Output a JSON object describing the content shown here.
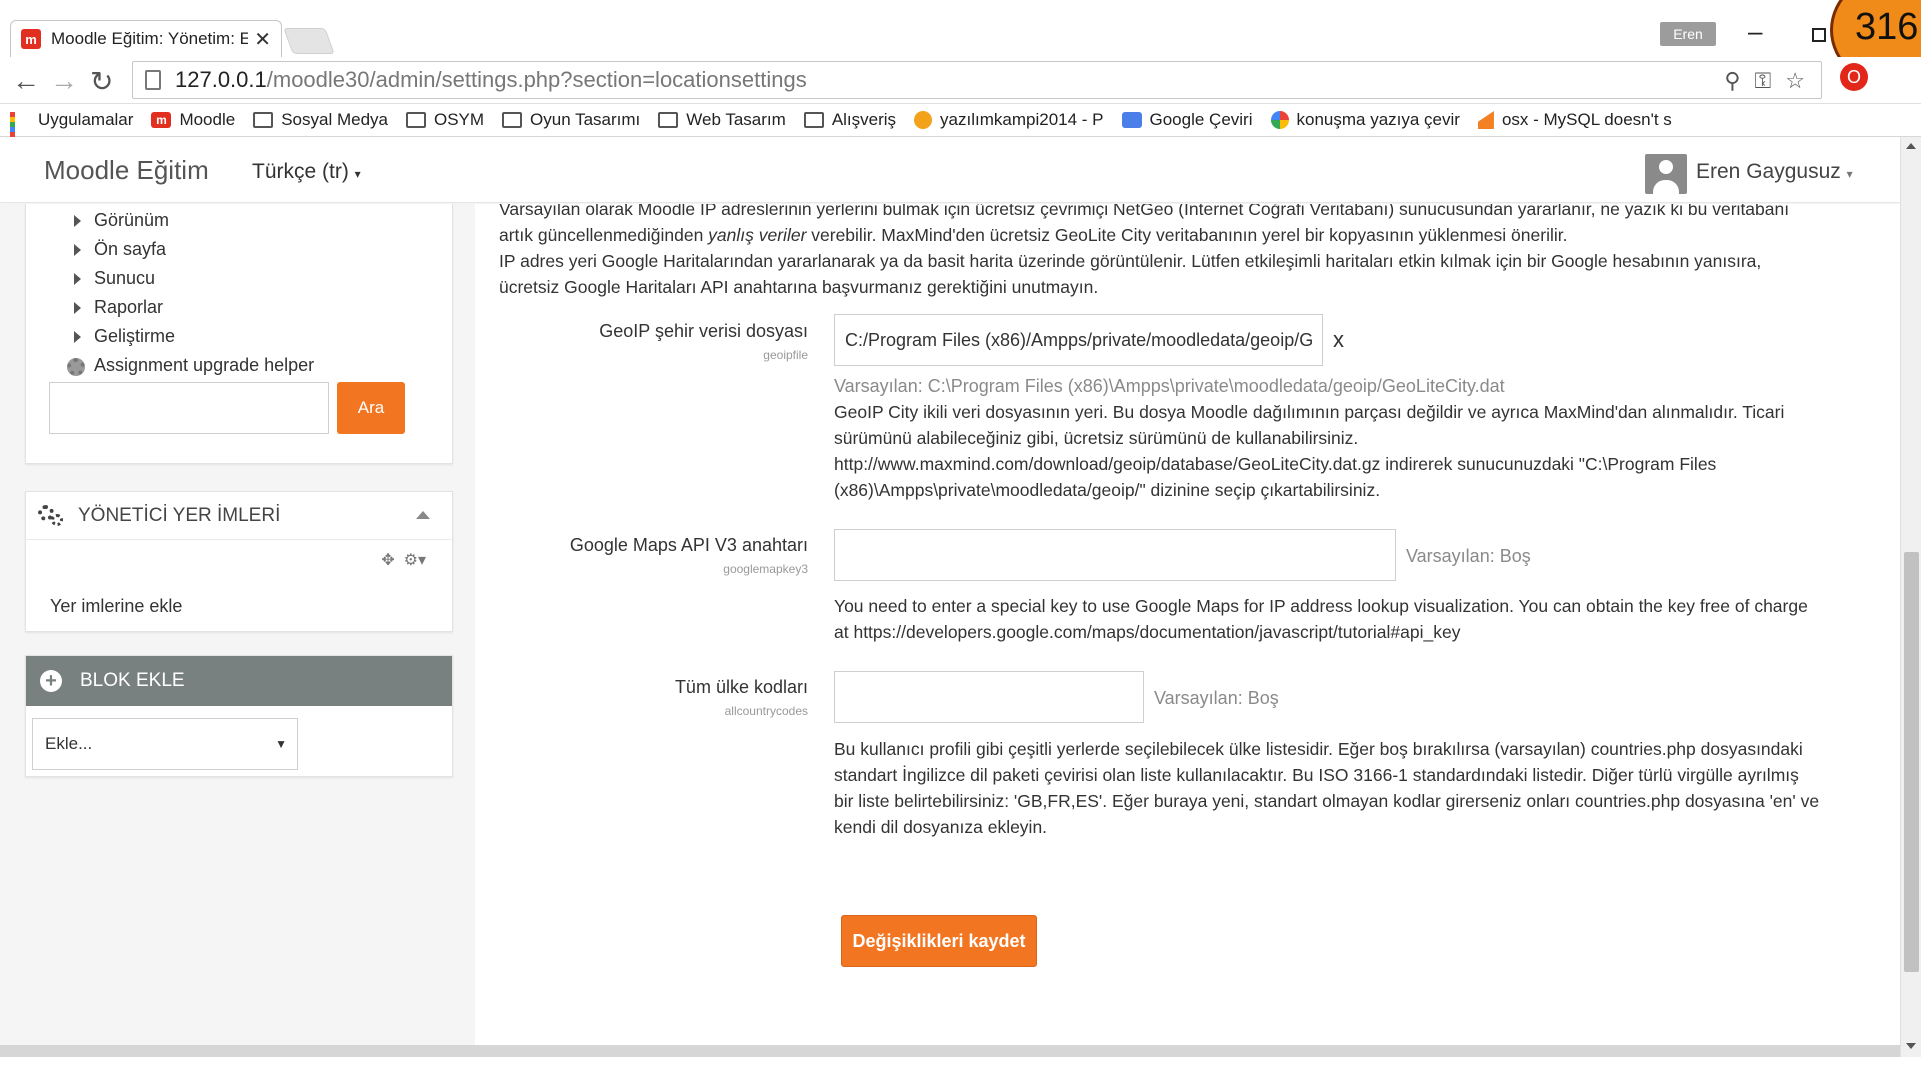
{
  "browser": {
    "tab_title": "Moodle Eğitim: Yönetim: E",
    "tab_close": "✕",
    "url_host": "127.0.0.1",
    "url_path": "/moodle30/admin/settings.php?section=locationsettings",
    "window_user": "Eren",
    "badge": "316"
  },
  "bookmarks": [
    {
      "label": "Uygulamalar",
      "icon": "apps-icon"
    },
    {
      "label": "Moodle",
      "icon": "moodle-icon"
    },
    {
      "label": "Sosyal Medya",
      "icon": "folder-icon"
    },
    {
      "label": "OSYM",
      "icon": "folder-icon"
    },
    {
      "label": "Oyun Tasarımı",
      "icon": "folder-icon"
    },
    {
      "label": "Web Tasarım",
      "icon": "folder-icon"
    },
    {
      "label": "Alışveriş",
      "icon": "folder-icon"
    },
    {
      "label": "yazılımkampi2014 - P",
      "icon": "tiger-icon"
    },
    {
      "label": "Google Çeviri",
      "icon": "google-translate-icon"
    },
    {
      "label": "konuşma yazıya çevir",
      "icon": "google-icon"
    },
    {
      "label": "osx - MySQL doesn't s",
      "icon": "stackoverflow-icon"
    }
  ],
  "header": {
    "brand": "Moodle Eğitim",
    "language": "Türkçe (tr)",
    "user_name": "Eren Gaygusuz"
  },
  "sidebar": {
    "nav_items": [
      "Görünüm",
      "Ön sayfa",
      "Sunucu",
      "Raporlar",
      "Geliştirme"
    ],
    "assignment_helper": "Assignment upgrade helper",
    "search_button": "Ara",
    "bookmarks_title": "YÖNETİCİ YER İMLERİ",
    "bookmarks_link": "Yer imlerine ekle",
    "add_block_title": "BLOK EKLE",
    "add_block_select": "Ekle..."
  },
  "content": {
    "intro_line1": "Varsayılan olarak Moodle IP adreslerinin yerlerini bulmak için ücretsiz çevrimiçi NetGeo (Internet Coğrafi Veritabanı) sunucusundan yararlanır, ne yazık ki bu veritabanı",
    "intro_line2a": "artık güncellenmediğinden ",
    "intro_line2_em": "yanlış veriler",
    "intro_line2b": " verebilir. MaxMind'den ücretsiz GeoLite City veritabanının yerel bir kopyasının yüklenmesi önerilir.",
    "intro_line3": "IP adres yeri Google Haritalarından yararlanarak ya da basit harita üzerinde görüntülenir. Lütfen etkileşimli haritaları etkin kılmak için bir Google hesabının yanısıra,",
    "intro_line4": "ücretsiz Google Haritaları API anahtarına başvurmanız gerektiğini unutmayın.",
    "geoip": {
      "label": "GeoIP şehir verisi dosyası",
      "key": "geoipfile",
      "value": "C:/Program Files (x86)/Ampps/private/moodledata/geoip/G",
      "clear": "x",
      "default": "Varsayılan: C:\\Program Files (x86)\\Ampps\\private\\moodledata/geoip/GeoLiteCity.dat",
      "desc1": "GeoIP City ikili veri dosyasının yeri. Bu dosya Moodle dağılımının parçası değildir ve ayrıca MaxMind'dan alınmalıdır. Ticari",
      "desc2": "sürümünü alabileceğiniz gibi, ücretsiz sürümünü de kullanabilirsiniz.",
      "desc3": "http://www.maxmind.com/download/geoip/database/GeoLiteCity.dat.gz indirerek sunucunuzdaki \"C:\\Program Files",
      "desc4": "(x86)\\Ampps\\private\\moodledata/geoip/\" dizinine seçip çıkartabilirsiniz."
    },
    "googlemap": {
      "label": "Google Maps API V3 anahtarı",
      "key": "googlemapkey3",
      "value": "",
      "default": "Varsayılan: Boş",
      "desc1": "You need to enter a special key to use Google Maps for IP address lookup visualization. You can obtain the key free of charge",
      "desc2": "at https://developers.google.com/maps/documentation/javascript/tutorial#api_key"
    },
    "countries": {
      "label": "Tüm ülke kodları",
      "key": "allcountrycodes",
      "value": "",
      "default": "Varsayılan: Boş",
      "desc1": "Bu kullanıcı profili gibi çeşitli yerlerde seçilebilecek ülke listesidir. Eğer boş bırakılırsa (varsayılan) countries.php dosyasındaki",
      "desc2": "standart İngilizce dil paketi çevirisi olan liste kullanılacaktır. Bu ISO 3166-1 standardındaki listedir. Diğer türlü virgülle ayrılmış",
      "desc3": "bir liste belirtebilirsiniz: 'GB,FR,ES'. Eğer buraya yeni, standart olmayan kodlar girerseniz onları countries.php dosyasına 'en' ve",
      "desc4": "kendi dil dosyanıza ekleyin."
    },
    "save_button": "Değişiklikleri kaydet"
  }
}
